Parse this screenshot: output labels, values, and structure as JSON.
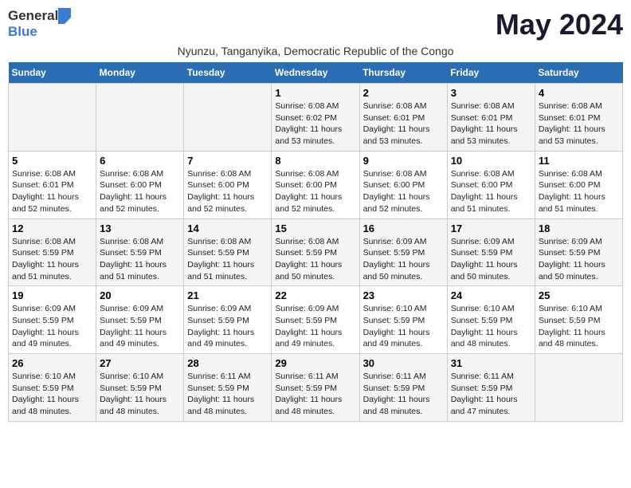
{
  "logo": {
    "general": "General",
    "blue": "Blue"
  },
  "title": "May 2024",
  "subtitle": "Nyunzu, Tanganyika, Democratic Republic of the Congo",
  "headers": [
    "Sunday",
    "Monday",
    "Tuesday",
    "Wednesday",
    "Thursday",
    "Friday",
    "Saturday"
  ],
  "weeks": [
    [
      {
        "day": "",
        "lines": []
      },
      {
        "day": "",
        "lines": []
      },
      {
        "day": "",
        "lines": []
      },
      {
        "day": "1",
        "lines": [
          "Sunrise: 6:08 AM",
          "Sunset: 6:02 PM",
          "Daylight: 11 hours",
          "and 53 minutes."
        ]
      },
      {
        "day": "2",
        "lines": [
          "Sunrise: 6:08 AM",
          "Sunset: 6:01 PM",
          "Daylight: 11 hours",
          "and 53 minutes."
        ]
      },
      {
        "day": "3",
        "lines": [
          "Sunrise: 6:08 AM",
          "Sunset: 6:01 PM",
          "Daylight: 11 hours",
          "and 53 minutes."
        ]
      },
      {
        "day": "4",
        "lines": [
          "Sunrise: 6:08 AM",
          "Sunset: 6:01 PM",
          "Daylight: 11 hours",
          "and 53 minutes."
        ]
      }
    ],
    [
      {
        "day": "5",
        "lines": [
          "Sunrise: 6:08 AM",
          "Sunset: 6:01 PM",
          "Daylight: 11 hours",
          "and 52 minutes."
        ]
      },
      {
        "day": "6",
        "lines": [
          "Sunrise: 6:08 AM",
          "Sunset: 6:00 PM",
          "Daylight: 11 hours",
          "and 52 minutes."
        ]
      },
      {
        "day": "7",
        "lines": [
          "Sunrise: 6:08 AM",
          "Sunset: 6:00 PM",
          "Daylight: 11 hours",
          "and 52 minutes."
        ]
      },
      {
        "day": "8",
        "lines": [
          "Sunrise: 6:08 AM",
          "Sunset: 6:00 PM",
          "Daylight: 11 hours",
          "and 52 minutes."
        ]
      },
      {
        "day": "9",
        "lines": [
          "Sunrise: 6:08 AM",
          "Sunset: 6:00 PM",
          "Daylight: 11 hours",
          "and 52 minutes."
        ]
      },
      {
        "day": "10",
        "lines": [
          "Sunrise: 6:08 AM",
          "Sunset: 6:00 PM",
          "Daylight: 11 hours",
          "and 51 minutes."
        ]
      },
      {
        "day": "11",
        "lines": [
          "Sunrise: 6:08 AM",
          "Sunset: 6:00 PM",
          "Daylight: 11 hours",
          "and 51 minutes."
        ]
      }
    ],
    [
      {
        "day": "12",
        "lines": [
          "Sunrise: 6:08 AM",
          "Sunset: 5:59 PM",
          "Daylight: 11 hours",
          "and 51 minutes."
        ]
      },
      {
        "day": "13",
        "lines": [
          "Sunrise: 6:08 AM",
          "Sunset: 5:59 PM",
          "Daylight: 11 hours",
          "and 51 minutes."
        ]
      },
      {
        "day": "14",
        "lines": [
          "Sunrise: 6:08 AM",
          "Sunset: 5:59 PM",
          "Daylight: 11 hours",
          "and 51 minutes."
        ]
      },
      {
        "day": "15",
        "lines": [
          "Sunrise: 6:08 AM",
          "Sunset: 5:59 PM",
          "Daylight: 11 hours",
          "and 50 minutes."
        ]
      },
      {
        "day": "16",
        "lines": [
          "Sunrise: 6:09 AM",
          "Sunset: 5:59 PM",
          "Daylight: 11 hours",
          "and 50 minutes."
        ]
      },
      {
        "day": "17",
        "lines": [
          "Sunrise: 6:09 AM",
          "Sunset: 5:59 PM",
          "Daylight: 11 hours",
          "and 50 minutes."
        ]
      },
      {
        "day": "18",
        "lines": [
          "Sunrise: 6:09 AM",
          "Sunset: 5:59 PM",
          "Daylight: 11 hours",
          "and 50 minutes."
        ]
      }
    ],
    [
      {
        "day": "19",
        "lines": [
          "Sunrise: 6:09 AM",
          "Sunset: 5:59 PM",
          "Daylight: 11 hours",
          "and 49 minutes."
        ]
      },
      {
        "day": "20",
        "lines": [
          "Sunrise: 6:09 AM",
          "Sunset: 5:59 PM",
          "Daylight: 11 hours",
          "and 49 minutes."
        ]
      },
      {
        "day": "21",
        "lines": [
          "Sunrise: 6:09 AM",
          "Sunset: 5:59 PM",
          "Daylight: 11 hours",
          "and 49 minutes."
        ]
      },
      {
        "day": "22",
        "lines": [
          "Sunrise: 6:09 AM",
          "Sunset: 5:59 PM",
          "Daylight: 11 hours",
          "and 49 minutes."
        ]
      },
      {
        "day": "23",
        "lines": [
          "Sunrise: 6:10 AM",
          "Sunset: 5:59 PM",
          "Daylight: 11 hours",
          "and 49 minutes."
        ]
      },
      {
        "day": "24",
        "lines": [
          "Sunrise: 6:10 AM",
          "Sunset: 5:59 PM",
          "Daylight: 11 hours",
          "and 48 minutes."
        ]
      },
      {
        "day": "25",
        "lines": [
          "Sunrise: 6:10 AM",
          "Sunset: 5:59 PM",
          "Daylight: 11 hours",
          "and 48 minutes."
        ]
      }
    ],
    [
      {
        "day": "26",
        "lines": [
          "Sunrise: 6:10 AM",
          "Sunset: 5:59 PM",
          "Daylight: 11 hours",
          "and 48 minutes."
        ]
      },
      {
        "day": "27",
        "lines": [
          "Sunrise: 6:10 AM",
          "Sunset: 5:59 PM",
          "Daylight: 11 hours",
          "and 48 minutes."
        ]
      },
      {
        "day": "28",
        "lines": [
          "Sunrise: 6:11 AM",
          "Sunset: 5:59 PM",
          "Daylight: 11 hours",
          "and 48 minutes."
        ]
      },
      {
        "day": "29",
        "lines": [
          "Sunrise: 6:11 AM",
          "Sunset: 5:59 PM",
          "Daylight: 11 hours",
          "and 48 minutes."
        ]
      },
      {
        "day": "30",
        "lines": [
          "Sunrise: 6:11 AM",
          "Sunset: 5:59 PM",
          "Daylight: 11 hours",
          "and 48 minutes."
        ]
      },
      {
        "day": "31",
        "lines": [
          "Sunrise: 6:11 AM",
          "Sunset: 5:59 PM",
          "Daylight: 11 hours",
          "and 47 minutes."
        ]
      },
      {
        "day": "",
        "lines": []
      }
    ]
  ]
}
